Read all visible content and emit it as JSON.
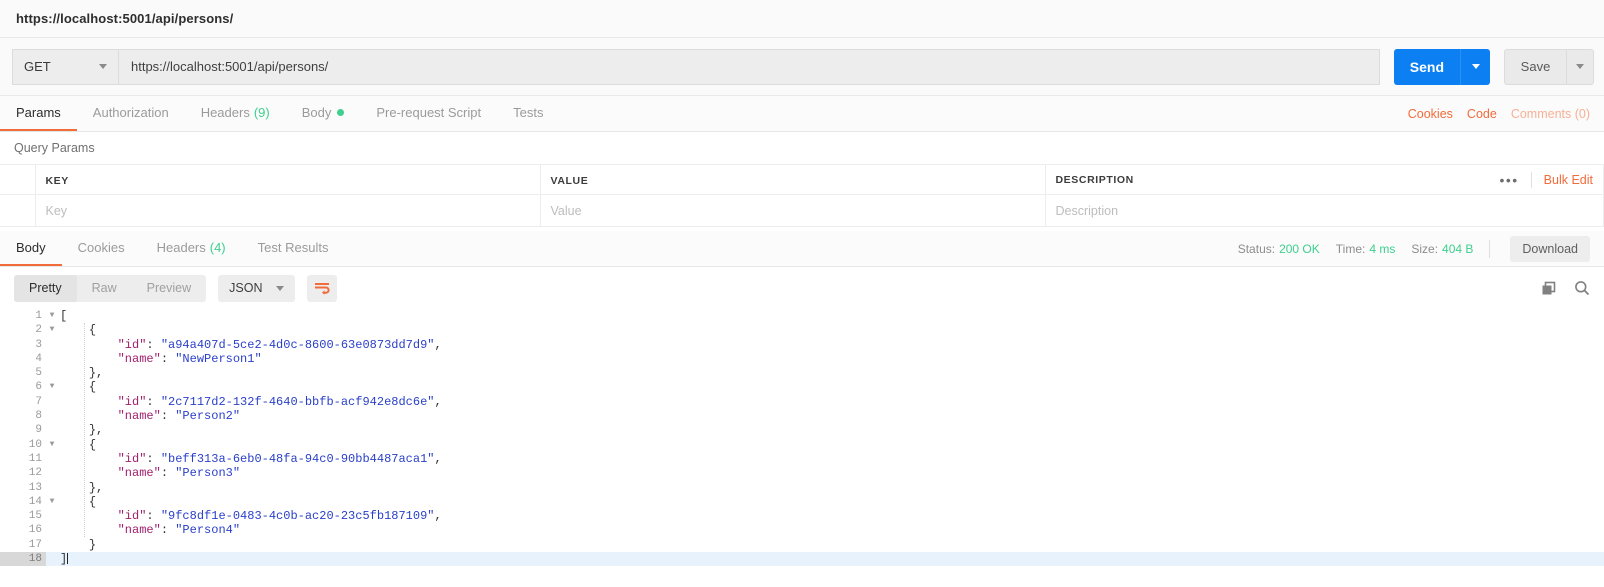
{
  "request": {
    "title": "https://localhost:5001/api/persons/",
    "method": "GET",
    "url": "https://localhost:5001/api/persons/",
    "send_label": "Send",
    "save_label": "Save"
  },
  "request_tabs": [
    {
      "label": "Params",
      "active": true
    },
    {
      "label": "Authorization",
      "active": false
    },
    {
      "label": "Headers",
      "count": "(9)",
      "active": false
    },
    {
      "label": "Body",
      "dot": true,
      "active": false
    },
    {
      "label": "Pre-request Script",
      "active": false
    },
    {
      "label": "Tests",
      "active": false
    }
  ],
  "request_links": {
    "cookies": "Cookies",
    "code": "Code",
    "comments": "Comments (0)"
  },
  "query_params": {
    "section_label": "Query Params",
    "columns": [
      "KEY",
      "VALUE",
      "DESCRIPTION"
    ],
    "bulk_edit_label": "Bulk Edit",
    "row_placeholders": [
      "Key",
      "Value",
      "Description"
    ]
  },
  "response_tabs": [
    {
      "label": "Body",
      "active": true
    },
    {
      "label": "Cookies",
      "active": false
    },
    {
      "label": "Headers",
      "count": "(4)",
      "active": false
    },
    {
      "label": "Test Results",
      "active": false
    }
  ],
  "response_meta": {
    "status_label": "Status:",
    "status_value": "200 OK",
    "time_label": "Time:",
    "time_value": "4 ms",
    "size_label": "Size:",
    "size_value": "404 B",
    "download_label": "Download"
  },
  "body_toolbar": {
    "views": [
      {
        "label": "Pretty",
        "active": true
      },
      {
        "label": "Raw",
        "active": false
      },
      {
        "label": "Preview",
        "active": false
      }
    ],
    "format": "JSON",
    "wrap_icon": "word-wrap-icon",
    "copy_icon": "copy-icon",
    "search_icon": "search-icon"
  },
  "colors": {
    "accent_orange": "#f26b3a",
    "send_blue": "#0c7ff2",
    "status_green": "#3fcf8e",
    "json_string": "#2a3fc9",
    "json_key": "#a11f6c"
  },
  "response_body": {
    "language": "json",
    "lines": [
      {
        "n": 1,
        "fold": true,
        "indent": 0,
        "tokens": [
          {
            "t": "punct",
            "v": "["
          }
        ],
        "cursor": false
      },
      {
        "n": 2,
        "fold": true,
        "indent": 1,
        "tokens": [
          {
            "t": "punct",
            "v": "{"
          }
        ],
        "cursor": false
      },
      {
        "n": 3,
        "fold": false,
        "indent": 2,
        "tokens": [
          {
            "t": "key",
            "v": "\"id\""
          },
          {
            "t": "punct",
            "v": ": "
          },
          {
            "t": "str",
            "v": "\"a94a407d-5ce2-4d0c-8600-63e0873dd7d9\""
          },
          {
            "t": "punct",
            "v": ","
          }
        ],
        "cursor": false
      },
      {
        "n": 4,
        "fold": false,
        "indent": 2,
        "tokens": [
          {
            "t": "key",
            "v": "\"name\""
          },
          {
            "t": "punct",
            "v": ": "
          },
          {
            "t": "str",
            "v": "\"NewPerson1\""
          }
        ],
        "cursor": false
      },
      {
        "n": 5,
        "fold": false,
        "indent": 1,
        "tokens": [
          {
            "t": "punct",
            "v": "},"
          }
        ],
        "cursor": false
      },
      {
        "n": 6,
        "fold": true,
        "indent": 1,
        "tokens": [
          {
            "t": "punct",
            "v": "{"
          }
        ],
        "cursor": false
      },
      {
        "n": 7,
        "fold": false,
        "indent": 2,
        "tokens": [
          {
            "t": "key",
            "v": "\"id\""
          },
          {
            "t": "punct",
            "v": ": "
          },
          {
            "t": "str",
            "v": "\"2c7117d2-132f-4640-bbfb-acf942e8dc6e\""
          },
          {
            "t": "punct",
            "v": ","
          }
        ],
        "cursor": false
      },
      {
        "n": 8,
        "fold": false,
        "indent": 2,
        "tokens": [
          {
            "t": "key",
            "v": "\"name\""
          },
          {
            "t": "punct",
            "v": ": "
          },
          {
            "t": "str",
            "v": "\"Person2\""
          }
        ],
        "cursor": false
      },
      {
        "n": 9,
        "fold": false,
        "indent": 1,
        "tokens": [
          {
            "t": "punct",
            "v": "},"
          }
        ],
        "cursor": false
      },
      {
        "n": 10,
        "fold": true,
        "indent": 1,
        "tokens": [
          {
            "t": "punct",
            "v": "{"
          }
        ],
        "cursor": false
      },
      {
        "n": 11,
        "fold": false,
        "indent": 2,
        "tokens": [
          {
            "t": "key",
            "v": "\"id\""
          },
          {
            "t": "punct",
            "v": ": "
          },
          {
            "t": "str",
            "v": "\"beff313a-6eb0-48fa-94c0-90bb4487aca1\""
          },
          {
            "t": "punct",
            "v": ","
          }
        ],
        "cursor": false
      },
      {
        "n": 12,
        "fold": false,
        "indent": 2,
        "tokens": [
          {
            "t": "key",
            "v": "\"name\""
          },
          {
            "t": "punct",
            "v": ": "
          },
          {
            "t": "str",
            "v": "\"Person3\""
          }
        ],
        "cursor": false
      },
      {
        "n": 13,
        "fold": false,
        "indent": 1,
        "tokens": [
          {
            "t": "punct",
            "v": "},"
          }
        ],
        "cursor": false
      },
      {
        "n": 14,
        "fold": true,
        "indent": 1,
        "tokens": [
          {
            "t": "punct",
            "v": "{"
          }
        ],
        "cursor": false
      },
      {
        "n": 15,
        "fold": false,
        "indent": 2,
        "tokens": [
          {
            "t": "key",
            "v": "\"id\""
          },
          {
            "t": "punct",
            "v": ": "
          },
          {
            "t": "str",
            "v": "\"9fc8df1e-0483-4c0b-ac20-23c5fb187109\""
          },
          {
            "t": "punct",
            "v": ","
          }
        ],
        "cursor": false
      },
      {
        "n": 16,
        "fold": false,
        "indent": 2,
        "tokens": [
          {
            "t": "key",
            "v": "\"name\""
          },
          {
            "t": "punct",
            "v": ": "
          },
          {
            "t": "str",
            "v": "\"Person4\""
          }
        ],
        "cursor": false
      },
      {
        "n": 17,
        "fold": false,
        "indent": 1,
        "tokens": [
          {
            "t": "punct",
            "v": "}"
          }
        ],
        "cursor": false
      },
      {
        "n": 18,
        "fold": false,
        "indent": 0,
        "tokens": [
          {
            "t": "punct",
            "v": "]"
          }
        ],
        "cursor": true
      }
    ]
  }
}
